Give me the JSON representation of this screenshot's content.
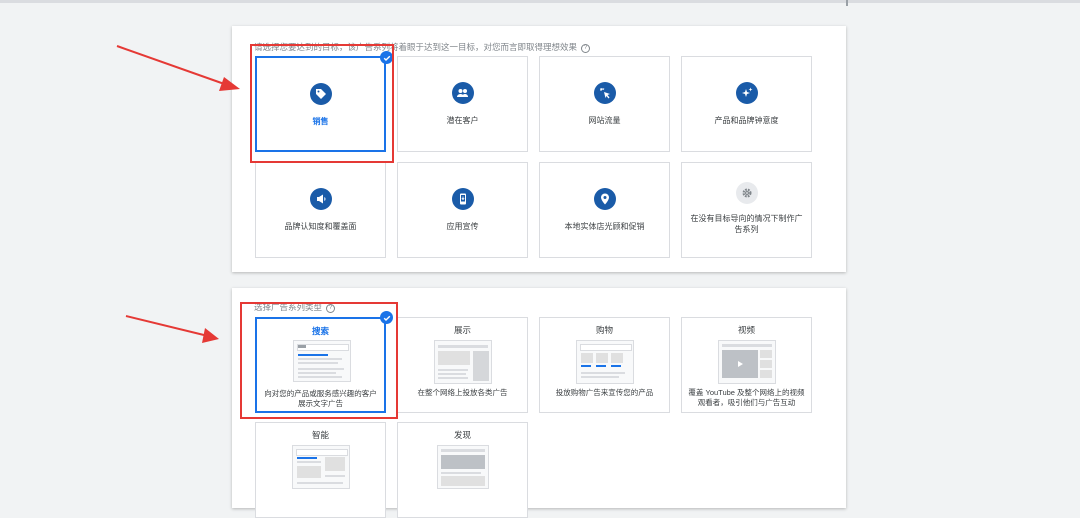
{
  "goals": {
    "prompt": "请选择您要达到的目标，该广告系列将着眼于达到这一目标，对您而言即取得理想效果",
    "help_glyph": "?",
    "items": [
      {
        "label": "销售",
        "icon": "tag-icon",
        "selected": true
      },
      {
        "label": "潜在客户",
        "icon": "people-icon",
        "selected": false
      },
      {
        "label": "网站流量",
        "icon": "cursor-click-icon",
        "selected": false
      },
      {
        "label": "产品和品牌钟意度",
        "icon": "sparkle-icon",
        "selected": false
      },
      {
        "label": "品牌认知度和覆盖面",
        "icon": "megaphone-icon",
        "selected": false
      },
      {
        "label": "应用宣传",
        "icon": "phone-icon",
        "selected": false
      },
      {
        "label": "本地实体店光顾和促销",
        "icon": "location-pin-icon",
        "selected": false
      },
      {
        "label": "在没有目标导向的情况下制作广告系列",
        "icon": "gear-icon",
        "selected": false
      }
    ]
  },
  "campaign_types": {
    "prompt": "选择广告系列类型",
    "help_glyph": "?",
    "items": [
      {
        "title": "搜索",
        "description": "向对您的产品或服务感兴趣的客户展示文字广告",
        "selected": true
      },
      {
        "title": "展示",
        "description": "在整个网络上投放各类广告",
        "selected": false
      },
      {
        "title": "购物",
        "description": "投放购物广告来宣传您的产品",
        "selected": false
      },
      {
        "title": "视频",
        "description": "覆盖 YouTube 及整个网络上的视频观看者，吸引他们与广告互动",
        "selected": false
      },
      {
        "title": "智能",
        "description": "",
        "selected": false
      },
      {
        "title": "发现",
        "description": "",
        "selected": false
      }
    ]
  },
  "colors": {
    "accent": "#1a73e8",
    "icon_circle": "#1a5ba8",
    "annotation_red": "#e53935"
  }
}
